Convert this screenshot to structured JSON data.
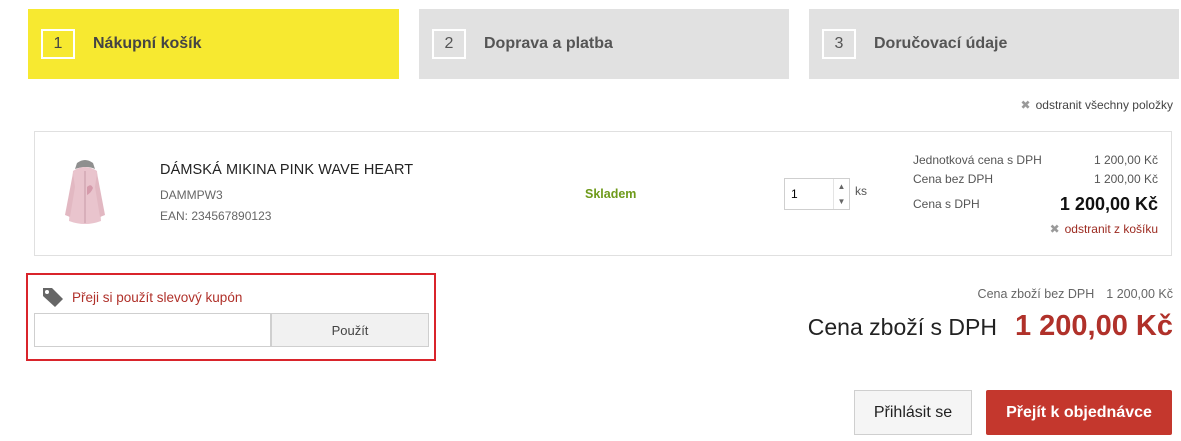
{
  "steps": [
    {
      "number": "1",
      "label": "Nákupní košík",
      "active": true
    },
    {
      "number": "2",
      "label": "Doprava a platba",
      "active": false
    },
    {
      "number": "3",
      "label": "Doručovací údaje",
      "active": false
    }
  ],
  "cart": {
    "remove_all_label": "odstranit všechny položky",
    "item": {
      "name": "DÁMSKÁ MIKINA PINK WAVE HEART",
      "code": "DAMMPW3",
      "ean": "EAN: 234567890123",
      "availability": "Skladem",
      "quantity": "1",
      "quantity_unit": "ks",
      "unit_price_label": "Jednotková cena s DPH",
      "unit_price_value": "1 200,00 Kč",
      "price_net_label": "Cena bez DPH",
      "price_net_value": "1 200,00 Kč",
      "price_gross_label": "Cena s DPH",
      "price_gross_value": "1 200,00 Kč",
      "remove_label": "odstranit z košíku"
    }
  },
  "coupon": {
    "prompt": "Přeji si použít slevový kupón",
    "input_value": "",
    "apply_label": "Použít"
  },
  "totals": {
    "net_label": "Cena zboží bez DPH",
    "net_value": "1 200,00 Kč",
    "gross_label": "Cena zboží s DPH",
    "gross_value": "1 200,00 Kč"
  },
  "actions": {
    "login_label": "Přihlásit se",
    "order_label": "Přejít k objednávce"
  },
  "colors": {
    "active_step": "#f7e930",
    "inactive_step": "#e1e1e1",
    "accent_red": "#c4372d",
    "stock_green": "#6e9a1a",
    "highlight_border": "#d9242b"
  }
}
